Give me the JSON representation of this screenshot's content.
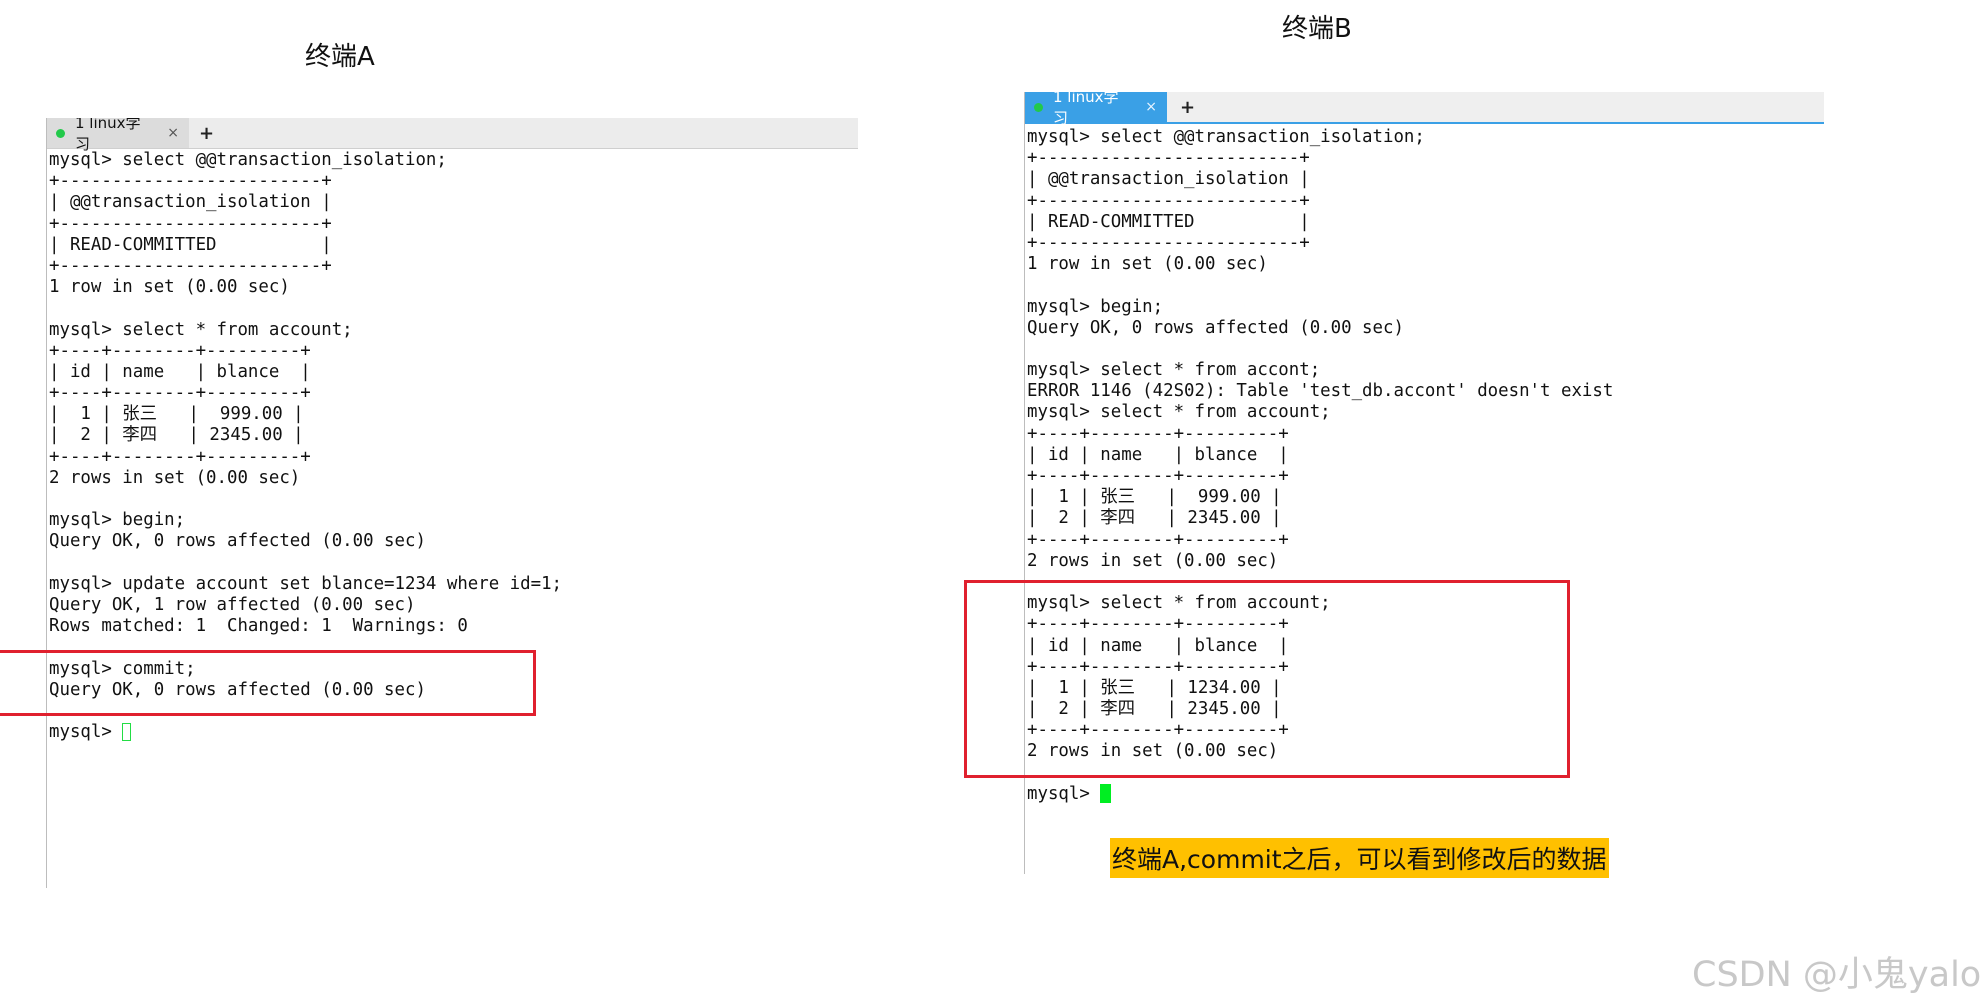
{
  "captions": {
    "terminal_a": "终端A",
    "terminal_b": "终端B"
  },
  "terminal_a": {
    "tab_label": "1 linux学习",
    "tab_close": "×",
    "tab_add": "+",
    "lines": [
      "mysql> select @@transaction_isolation;",
      "+-------------------------+",
      "| @@transaction_isolation |",
      "+-------------------------+",
      "| READ-COMMITTED          |",
      "+-------------------------+",
      "1 row in set (0.00 sec)",
      "",
      "mysql> select * from account;",
      "+----+--------+---------+",
      "| id | name   | blance  |",
      "+----+--------+---------+",
      "|  1 | 张三   |  999.00 |",
      "|  2 | 李四   | 2345.00 |",
      "+----+--------+---------+",
      "2 rows in set (0.00 sec)",
      "",
      "mysql> begin;",
      "Query OK, 0 rows affected (0.00 sec)",
      "",
      "mysql> update account set blance=1234 where id=1;",
      "Query OK, 1 row affected (0.00 sec)",
      "Rows matched: 1  Changed: 1  Warnings: 0",
      "",
      "mysql> commit;",
      "Query OK, 0 rows affected (0.00 sec)",
      "",
      "mysql> "
    ]
  },
  "terminal_b": {
    "tab_label": "1 linux学习",
    "tab_close": "×",
    "tab_add": "+",
    "lines": [
      "mysql> select @@transaction_isolation;",
      "+-------------------------+",
      "| @@transaction_isolation |",
      "+-------------------------+",
      "| READ-COMMITTED          |",
      "+-------------------------+",
      "1 row in set (0.00 sec)",
      "",
      "mysql> begin;",
      "Query OK, 0 rows affected (0.00 sec)",
      "",
      "mysql> select * from accont;",
      "ERROR 1146 (42S02): Table 'test_db.accont' doesn't exist",
      "mysql> select * from account;",
      "+----+--------+---------+",
      "| id | name   | blance  |",
      "+----+--------+---------+",
      "|  1 | 张三   |  999.00 |",
      "|  2 | 李四   | 2345.00 |",
      "+----+--------+---------+",
      "2 rows in set (0.00 sec)",
      "",
      "mysql> select * from account;",
      "+----+--------+---------+",
      "| id | name   | blance  |",
      "+----+--------+---------+",
      "|  1 | 张三   | 1234.00 |",
      "|  2 | 李四   | 2345.00 |",
      "+----+--------+---------+",
      "2 rows in set (0.00 sec)",
      "",
      "mysql> "
    ]
  },
  "note": "终端A,commit之后，可以看到修改后的数据",
  "watermark": "CSDN @小鬼yalo",
  "colors": {
    "highlight_border": "#e0202e",
    "note_background": "#ffc000",
    "tab_active_b": "#3aa0e6",
    "status_dot": "#22c94a",
    "cursor": "#00ee22"
  }
}
